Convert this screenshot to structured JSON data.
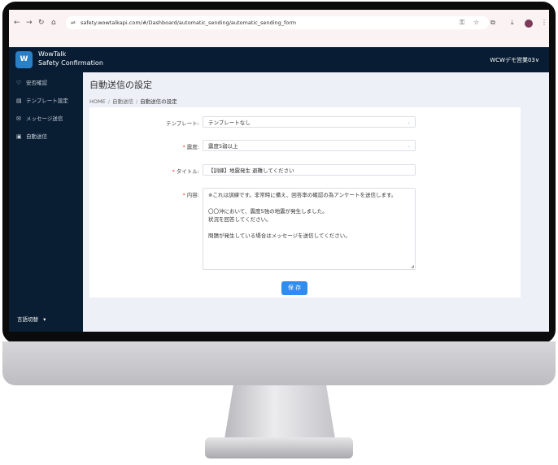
{
  "browser": {
    "url": "safety.wowtalkapi.com/#/Dashboard/automatic_sending/automatic_sending_form"
  },
  "header": {
    "brand_line1": "WowTalk",
    "brand_line2": "Safety Confirmation",
    "user_label": "WCWデモ営業03∨"
  },
  "sidebar": {
    "items": [
      {
        "icon": "heart-icon",
        "label": "安否確認"
      },
      {
        "icon": "template-icon",
        "label": "テンプレート設定"
      },
      {
        "icon": "mail-icon",
        "label": "メッセージ送信"
      },
      {
        "icon": "auto-send-icon",
        "label": "自動送信"
      }
    ],
    "language_label": "言語切替"
  },
  "main": {
    "title": "自動送信の設定",
    "breadcrumb": [
      "HOME",
      "自動送信",
      "自動送信の設定"
    ]
  },
  "form": {
    "template_label": "テンプレート:",
    "template_value": "テンプレートなし",
    "intensity_label": "震度:",
    "intensity_value": "震度5弱以上",
    "title_label": "タイトル:",
    "title_value": "【訓練】地震発生 避難してください",
    "content_label": "内容:",
    "content_lines": [
      "※これは訓練です。非常時に備え、回答率の確認の為アンケートを送信します。",
      "",
      "〇〇沖において、震度5強の地震が発生しました。",
      "状況を回答してください。",
      "",
      "問題が発生している場合はメッセージを送信してください。"
    ],
    "save_label": "保 存"
  }
}
